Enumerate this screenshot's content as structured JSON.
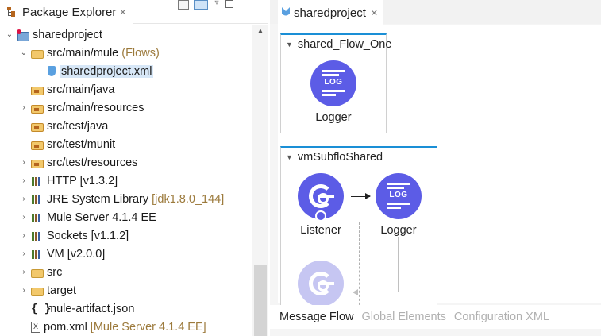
{
  "left_panel": {
    "tab_label": "Package Explorer",
    "tab_close": "×",
    "tree": [
      {
        "label": "sharedproject",
        "decoration": "",
        "icon": "project-icon",
        "twist": "⌄",
        "level": 0
      },
      {
        "label": "src/main/mule",
        "decoration": "(Flows)",
        "icon": "folder-open-icon",
        "twist": "⌄",
        "level": 1
      },
      {
        "label": "sharedproject.xml",
        "decoration": "",
        "icon": "mule-xml-icon",
        "twist": "",
        "level": 2,
        "selected": true
      },
      {
        "label": "src/main/java",
        "decoration": "",
        "icon": "package-folder-icon",
        "twist": "",
        "level": 1
      },
      {
        "label": "src/main/resources",
        "decoration": "",
        "icon": "package-folder-icon",
        "twist": "›",
        "level": 1
      },
      {
        "label": "src/test/java",
        "decoration": "",
        "icon": "package-folder-icon",
        "twist": "",
        "level": 1
      },
      {
        "label": "src/test/munit",
        "decoration": "",
        "icon": "package-folder-icon",
        "twist": "",
        "level": 1
      },
      {
        "label": "src/test/resources",
        "decoration": "",
        "icon": "package-folder-icon",
        "twist": "›",
        "level": 1
      },
      {
        "label": "HTTP [v1.3.2]",
        "decoration": "",
        "icon": "library-icon",
        "twist": "›",
        "level": 1
      },
      {
        "label": "JRE System Library",
        "decoration": "[jdk1.8.0_144]",
        "icon": "library-icon",
        "twist": "›",
        "level": 1
      },
      {
        "label": "Mule Server 4.1.4 EE",
        "decoration": "",
        "icon": "library-icon",
        "twist": "›",
        "level": 1
      },
      {
        "label": "Sockets [v1.1.2]",
        "decoration": "",
        "icon": "library-icon",
        "twist": "›",
        "level": 1
      },
      {
        "label": "VM [v2.0.0]",
        "decoration": "",
        "icon": "library-icon",
        "twist": "›",
        "level": 1
      },
      {
        "label": "src",
        "decoration": "",
        "icon": "folder-icon",
        "twist": "›",
        "level": 1
      },
      {
        "label": "target",
        "decoration": "",
        "icon": "folder-icon",
        "twist": "›",
        "level": 1
      },
      {
        "label": "mule-artifact.json",
        "decoration": "",
        "icon": "json-icon",
        "twist": "",
        "level": 1
      },
      {
        "label": "pom.xml",
        "decoration": "[Mule Server 4.1.4 EE]",
        "icon": "pom-xml-icon",
        "twist": "",
        "level": 1
      }
    ]
  },
  "editor": {
    "tab_label": "sharedproject",
    "tab_close": "×",
    "flows": [
      {
        "name": "shared_Flow_One",
        "nodes": [
          {
            "label": "Logger",
            "glyph": "LOG"
          }
        ]
      },
      {
        "name": "vmSubfloShared",
        "nodes": [
          {
            "label": "Listener"
          },
          {
            "label": "Logger",
            "glyph": "LOG"
          }
        ]
      }
    ],
    "bottom_tabs": [
      "Message Flow",
      "Global Elements",
      "Configuration XML"
    ],
    "active_bottom_tab": "Message Flow"
  },
  "colors": {
    "node_fill": "#5c5ce6",
    "flow_top_border": "#1a8fd6",
    "decoration_text": "#9c7a3c",
    "inactive_tab_text": "#b0b0b0"
  }
}
